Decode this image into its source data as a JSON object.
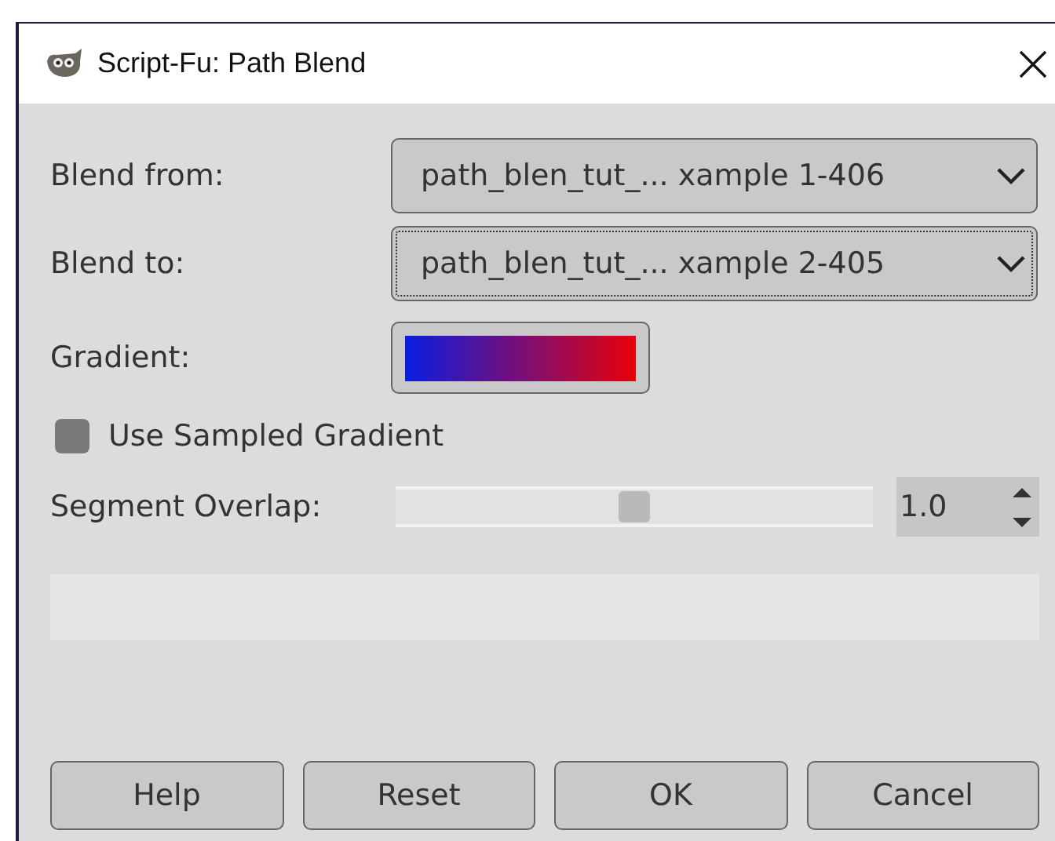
{
  "window": {
    "title": "Script-Fu: Path Blend"
  },
  "fields": [
    {
      "kind": "combo",
      "label": "Blend from:",
      "value": "path_blen_tut_... xample 1-406",
      "focused": false
    },
    {
      "kind": "combo",
      "label": "Blend to:",
      "value": "path_blen_tut_... xample 2-405",
      "focused": true
    },
    {
      "kind": "gradient",
      "label": "Gradient:"
    },
    {
      "kind": "checkbox",
      "label": "Use Sampled Gradient",
      "checked": false
    },
    {
      "kind": "slider",
      "label": "Segment Overlap:",
      "level": 0.5,
      "value": "1.0"
    }
  ],
  "progress": {
    "level": 0
  },
  "buttons": [
    "Help",
    "Reset",
    "OK",
    "Cancel"
  ]
}
